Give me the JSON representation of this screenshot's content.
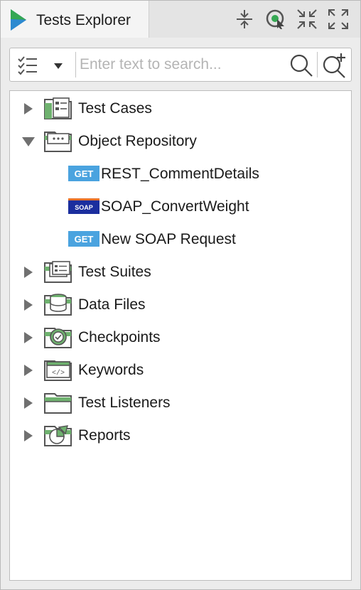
{
  "panel": {
    "tab_title": "Tests Explorer",
    "toolbar_icons": [
      "collapse-vertical-icon",
      "link-with-editor-icon",
      "minimize-icon",
      "maximize-icon"
    ]
  },
  "search": {
    "placeholder": "Enter text to search...",
    "value": ""
  },
  "tree": {
    "items": [
      {
        "label": "Test Cases",
        "icon": "test-cases-folder-icon",
        "expanded": false
      },
      {
        "label": "Object Repository",
        "icon": "object-repository-folder-icon",
        "expanded": true,
        "children": [
          {
            "label": "REST_CommentDetails",
            "badge": "GET"
          },
          {
            "label": "SOAP_ConvertWeight",
            "badge": "SOAP"
          },
          {
            "label": "New SOAP Request",
            "badge": "GET"
          }
        ]
      },
      {
        "label": "Test Suites",
        "icon": "test-suites-folder-icon",
        "expanded": false
      },
      {
        "label": "Data Files",
        "icon": "data-files-folder-icon",
        "expanded": false
      },
      {
        "label": "Checkpoints",
        "icon": "checkpoints-folder-icon",
        "expanded": false
      },
      {
        "label": "Keywords",
        "icon": "keywords-folder-icon",
        "expanded": false
      },
      {
        "label": "Test Listeners",
        "icon": "test-listeners-folder-icon",
        "expanded": false
      },
      {
        "label": "Reports",
        "icon": "reports-folder-icon",
        "expanded": false
      }
    ]
  },
  "colors": {
    "folder_green": "#6fb26f",
    "folder_gray": "#5a5a5a",
    "get_badge": "#4aa3df",
    "soap_badge": "#1b2e9e",
    "soap_badge_stripe": "#e8732a",
    "logo_green": "#35a853",
    "logo_blue": "#2a6cb5"
  }
}
